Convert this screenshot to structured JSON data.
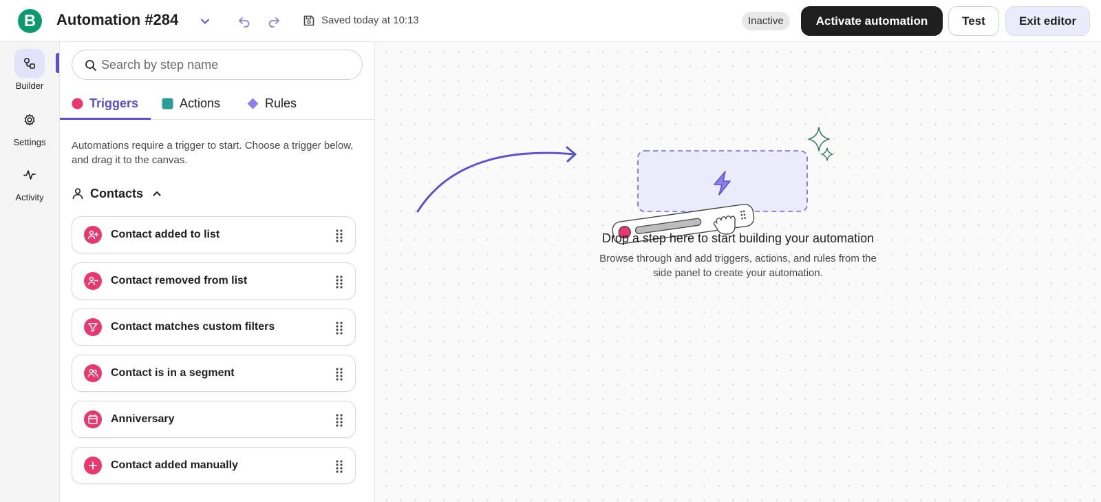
{
  "header": {
    "logo_letter": "B",
    "title": "Automation #284",
    "saved_text": "Saved today at 10:13",
    "status_badge": "Inactive",
    "activate_label": "Activate automation",
    "test_label": "Test",
    "exit_label": "Exit editor"
  },
  "rail": {
    "items": [
      {
        "label": "Builder",
        "icon": "builder-icon",
        "active": true
      },
      {
        "label": "Settings",
        "icon": "gear-icon",
        "active": false
      },
      {
        "label": "Activity",
        "icon": "activity-icon",
        "active": false
      }
    ]
  },
  "panel": {
    "search_placeholder": "Search by step name",
    "tabs": [
      {
        "label": "Triggers",
        "color": "#e8386d",
        "active": true
      },
      {
        "label": "Actions",
        "color": "#2a9d9a",
        "active": false
      },
      {
        "label": "Rules",
        "color": "#8e80e8",
        "active": false
      }
    ],
    "help_text": "Automations require a trigger to start. Choose a trigger below, and drag it to the canvas.",
    "section": {
      "title": "Contacts",
      "expanded": true,
      "items": [
        {
          "label": "Contact added to list",
          "icon": "person-plus-icon"
        },
        {
          "label": "Contact removed from list",
          "icon": "person-minus-icon"
        },
        {
          "label": "Contact matches custom filters",
          "icon": "filter-icon"
        },
        {
          "label": "Contact is in a segment",
          "icon": "people-icon"
        },
        {
          "label": "Anniversary",
          "icon": "calendar-icon"
        },
        {
          "label": "Contact added manually",
          "icon": "plus-icon"
        }
      ]
    }
  },
  "canvas": {
    "drop_title": "Drop a step here to start building your automation",
    "drop_subtitle": "Browse through and add triggers, actions, and rules from the side panel to create your automation."
  },
  "colors": {
    "accent": "#5b4fd4",
    "brand": "#0b996e",
    "trigger": "#e8386d",
    "action": "#2a9d9a",
    "rule": "#8e80e8"
  }
}
